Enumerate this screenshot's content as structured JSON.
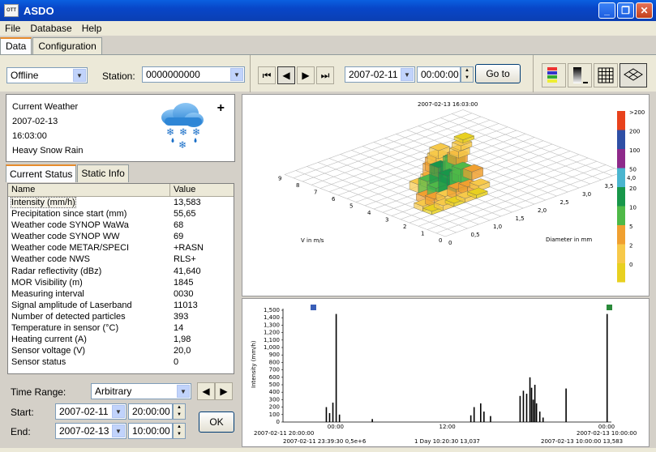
{
  "window": {
    "icon_label": "OTT",
    "title": "ASDO",
    "controls": [
      "_",
      "❐",
      "✕"
    ]
  },
  "menu": [
    "File",
    "Database",
    "Help"
  ],
  "tabs": [
    "Data",
    "Configuration"
  ],
  "toolbar": {
    "mode": "Offline",
    "station_label": "Station:",
    "station_value": "0000000000",
    "date": "2007-02-11",
    "time": "00:00:00",
    "goto_label": "Go to"
  },
  "weather": {
    "title": "Current Weather",
    "date": "2007-02-13",
    "time": "16:03:00",
    "condition": "Heavy Snow Rain",
    "plus": "+"
  },
  "subtabs": [
    "Current Status",
    "Static Info"
  ],
  "status_table": {
    "headers": [
      "Name",
      "Value"
    ],
    "rows": [
      [
        "Intensity (mm/h)",
        "13,583"
      ],
      [
        "Precipitation since start (mm)",
        "55,65"
      ],
      [
        "Weather code SYNOP WaWa",
        "68"
      ],
      [
        "Weather code SYNOP WW",
        "69"
      ],
      [
        "Weather code METAR/SPECI",
        "+RASN"
      ],
      [
        "Weather code NWS",
        "RLS+"
      ],
      [
        "Radar reflectivity (dBz)",
        "41,640"
      ],
      [
        "MOR Visibility (m)",
        "1845"
      ],
      [
        "Measuring interval",
        "0030"
      ],
      [
        "Signal amplitude of Laserband",
        "11013"
      ],
      [
        "Number of detected particles",
        "393"
      ],
      [
        "Temperature in sensor (°C)",
        "14"
      ],
      [
        "Heating current (A)",
        "1,98"
      ],
      [
        "Sensor voltage (V)",
        "20,0"
      ],
      [
        "Sensor status",
        "0"
      ]
    ]
  },
  "time_range": {
    "label": "Time Range:",
    "value": "Arbitrary",
    "start_label": "Start:",
    "start_date": "2007-02-11",
    "start_time": "20:00:00",
    "end_label": "End:",
    "end_date": "2007-02-13",
    "end_time": "10:00:00",
    "ok_label": "OK"
  },
  "chart3d": {
    "title": "2007-02-13  16:03:00",
    "v_axis_label": "V in m/s",
    "d_axis_label": "Diameter in mm",
    "v_ticks": [
      "9",
      "8",
      "7",
      "6",
      "5",
      "4",
      "3",
      "2",
      "1",
      "0"
    ],
    "d_ticks": [
      "0",
      "0,5",
      "1,0",
      "1,5",
      "2,0",
      "2,5",
      "3,0",
      "3,5",
      "4,0"
    ],
    "legend": [
      {
        "label": ">200",
        "color": "#e8421c"
      },
      {
        "label": "200",
        "color": "#2f4fa5"
      },
      {
        "label": "100",
        "color": "#8e2a8a"
      },
      {
        "label": "50",
        "color": "#4ab5cf"
      },
      {
        "label": "20",
        "color": "#18974a"
      },
      {
        "label": "10",
        "color": "#4fb948"
      },
      {
        "label": "5",
        "color": "#f0a030"
      },
      {
        "label": "2",
        "color": "#f7c94a"
      },
      {
        "label": "0",
        "color": "#e8d020"
      }
    ]
  },
  "chart_data": {
    "type": "bar",
    "title": "",
    "ylabel": "Intensity (mm/h)",
    "ylim": [
      0,
      1500
    ],
    "y_ticks": [
      "1,500",
      "1,400",
      "1,300",
      "1,200",
      "1,100",
      "1,000",
      "900",
      "800",
      "700",
      "600",
      "500",
      "400",
      "300",
      "200",
      "100",
      "0"
    ],
    "x_ticks": [
      "00:00",
      "12:00",
      "00:00"
    ],
    "footer_left": "2007-02-11  20:00:00",
    "footer_right": "2007-02-13  10:00:00",
    "footer_left2": "2007-02-11  23:39:30    0,5e+6",
    "footer_mid": "1 Day  10:20:30    13,037",
    "footer_right2": "2007-02-13  10:00:00    13,583",
    "bars": [
      {
        "x": 0.16,
        "v": 1450
      },
      {
        "x": 0.13,
        "v": 200
      },
      {
        "x": 0.14,
        "v": 120
      },
      {
        "x": 0.15,
        "v": 260
      },
      {
        "x": 0.17,
        "v": 100
      },
      {
        "x": 0.27,
        "v": 40
      },
      {
        "x": 0.57,
        "v": 90
      },
      {
        "x": 0.58,
        "v": 200
      },
      {
        "x": 0.6,
        "v": 250
      },
      {
        "x": 0.61,
        "v": 140
      },
      {
        "x": 0.63,
        "v": 80
      },
      {
        "x": 0.72,
        "v": 350
      },
      {
        "x": 0.73,
        "v": 420
      },
      {
        "x": 0.74,
        "v": 380
      },
      {
        "x": 0.75,
        "v": 600
      },
      {
        "x": 0.755,
        "v": 460
      },
      {
        "x": 0.76,
        "v": 300
      },
      {
        "x": 0.765,
        "v": 500
      },
      {
        "x": 0.77,
        "v": 250
      },
      {
        "x": 0.78,
        "v": 140
      },
      {
        "x": 0.79,
        "v": 60
      },
      {
        "x": 0.86,
        "v": 450
      },
      {
        "x": 0.985,
        "v": 1450
      }
    ]
  }
}
